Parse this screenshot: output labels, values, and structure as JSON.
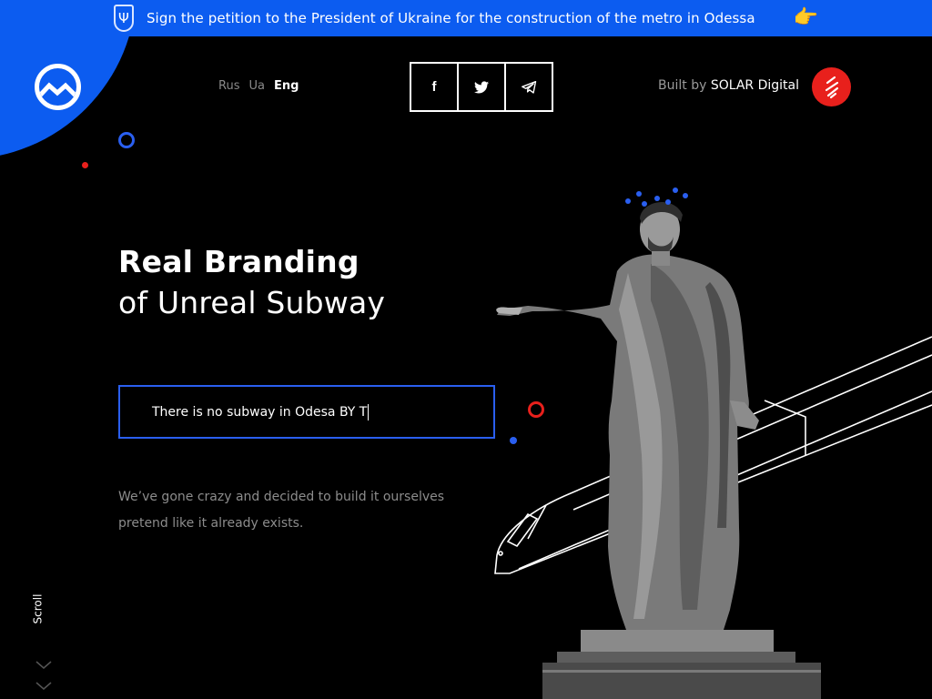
{
  "banner": {
    "text": "Sign the petition to the President of Ukraine for the construction of the metro in Odessa",
    "emblem": "ukraine-trident-icon",
    "pointer_icon": "pointing-hand-icon"
  },
  "header": {
    "languages": [
      {
        "label": "Rus",
        "active": false
      },
      {
        "label": "Ua",
        "active": false
      },
      {
        "label": "Eng",
        "active": true
      }
    ],
    "social": [
      {
        "label": "f",
        "icon": "facebook-icon"
      },
      {
        "label": "twitter",
        "icon": "twitter-icon"
      },
      {
        "label": "telegram",
        "icon": "telegram-icon"
      }
    ],
    "built_prefix": "Built by",
    "built_brand": "SOLAR Digital"
  },
  "hero": {
    "title_line1": "Real Branding",
    "title_line2": "of Unreal Subway",
    "ticker_text": "There is no subway in Odesa BY T",
    "description": "We’ve gone crazy and decided to build it ourselves pretend like it already exists."
  },
  "scroll": {
    "label": "Scroll"
  },
  "colors": {
    "accent_blue": "#0c5cf0",
    "accent_red": "#e8201c",
    "background": "#000000",
    "muted_text": "#8c8c8c"
  }
}
